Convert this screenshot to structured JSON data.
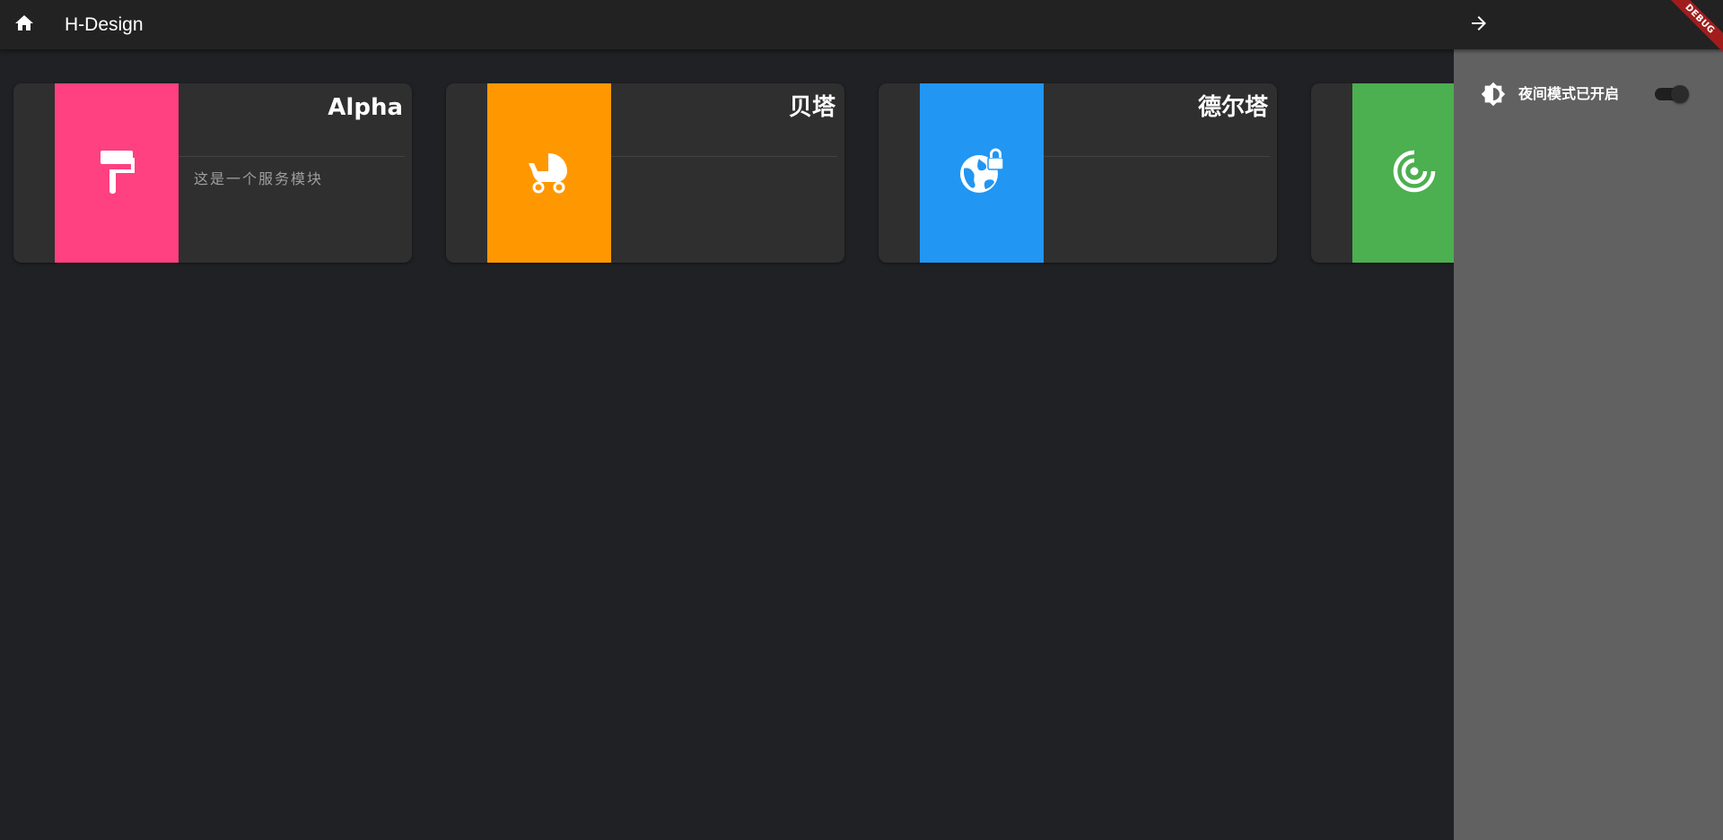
{
  "appbar": {
    "title": "H-Design",
    "home_icon": "home-icon",
    "forward_icon": "arrow-forward-icon",
    "background": "#222222"
  },
  "debug_banner": {
    "label": "DEBUG",
    "color": "#a11d1d"
  },
  "cards": [
    {
      "title": "Alpha",
      "description": "这是一个服务模块",
      "color": "#ff4081",
      "icon": "paint-roller-icon"
    },
    {
      "title": "贝塔",
      "description": "",
      "color": "#ff9800",
      "icon": "baby-stroller-icon"
    },
    {
      "title": "德尔塔",
      "description": "",
      "color": "#2196f3",
      "icon": "vpn-lock-globe-icon"
    },
    {
      "title": "",
      "description": "",
      "color": "#4caf50",
      "icon": "radar-target-icon"
    }
  ],
  "drawer": {
    "icon": "brightness-icon",
    "night_mode_label": "夜间模式已开启",
    "night_mode_on": true,
    "background": "#616161"
  },
  "colors": {
    "page_background": "#202124",
    "card_background": "#2f2f2f"
  }
}
